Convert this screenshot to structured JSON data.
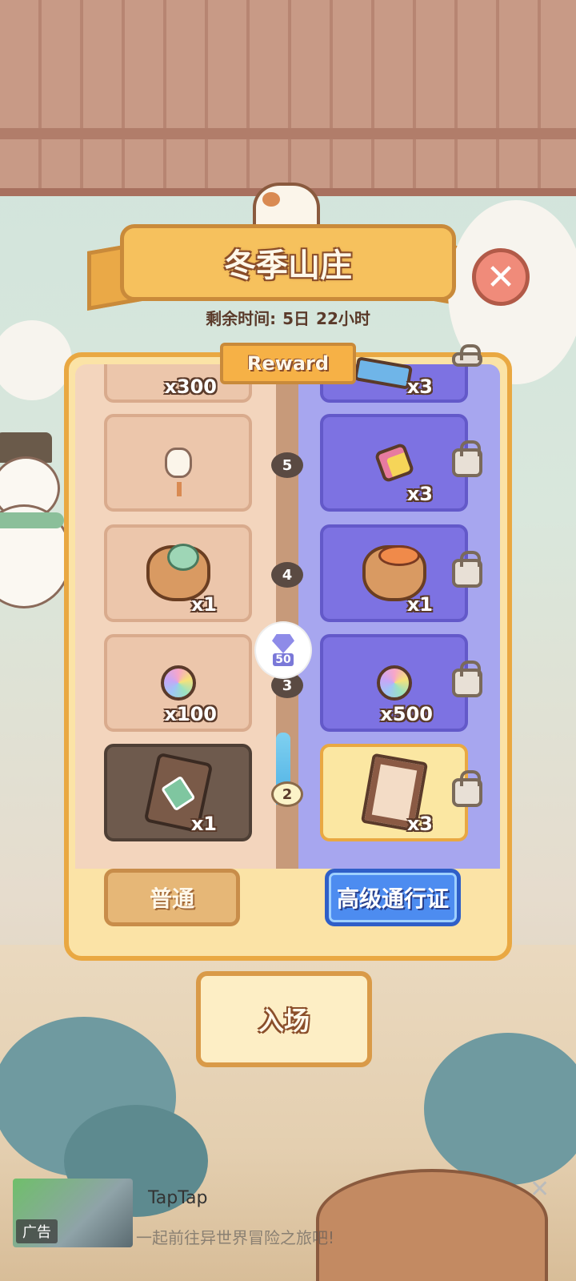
{
  "header": {
    "title": "冬季山庄",
    "remaining_label": "剩余时间:",
    "remaining_days": "5日",
    "remaining_hours": "22小时"
  },
  "panel": {
    "tag": "Reward"
  },
  "tiers": [
    {
      "level": "",
      "free": {
        "icon": "gem-pile-icon",
        "qty": "x300"
      },
      "premium": {
        "icon": "card-icon",
        "qty": "x3"
      }
    },
    {
      "level": "5",
      "free": {
        "icon": "cat-doll-icon",
        "qty": ""
      },
      "premium": {
        "icon": "cookie-icon",
        "qty": "x3"
      }
    },
    {
      "level": "4",
      "free": {
        "icon": "yarn-basket-icon",
        "qty": "x1"
      },
      "premium": {
        "icon": "food-basket-icon",
        "qty": "x1"
      }
    },
    {
      "level": "3",
      "free": {
        "icon": "rainbow-orb-icon",
        "qty": "x100"
      },
      "premium": {
        "icon": "rainbow-orb-icon",
        "qty": "x500"
      }
    },
    {
      "level": "2",
      "free": {
        "icon": "heart-card-icon",
        "qty": "x1"
      },
      "premium": {
        "icon": "pattern-card-icon",
        "qty": "x3"
      }
    }
  ],
  "gem_cost": "50",
  "tabs": {
    "normal": "普通",
    "premium": "高级通行证"
  },
  "enter_label": "入场",
  "ad": {
    "badge": "广告",
    "title": "TapTap",
    "desc": "一起前往异世界冒险之旅吧!",
    "close": "✕"
  },
  "colors": {
    "free_lane": "#f3d5bd",
    "premium_lane": "#a7a6ef",
    "accent": "#e9a842",
    "premium_button": "#4d8cf0"
  }
}
